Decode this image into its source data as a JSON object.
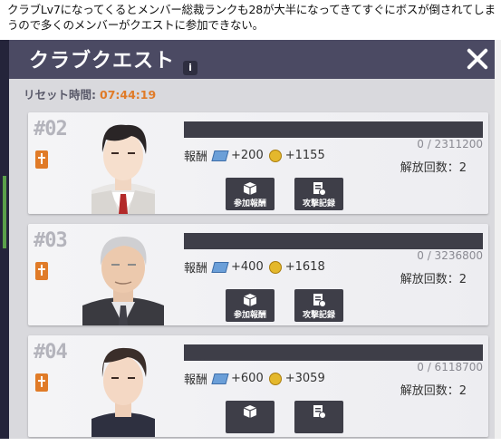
{
  "caption": "クラブLv7になってくるとメンバー総裁ランクも28が大半になってきてすぐにボスが倒されてしまうので多くのメンバーがクエストに参加できない。",
  "header": {
    "title": "クラブクエスト",
    "info_glyph": "i"
  },
  "reset": {
    "label": "リセット時間:",
    "time": "07:44:19"
  },
  "cards": [
    {
      "num": "#02",
      "reward_label": "報酬",
      "book": "+200",
      "coin": "+1155",
      "progress": "0 / 2311200",
      "release": "解放回数：2",
      "btn1": "参加報酬",
      "btn2": "攻撃記録"
    },
    {
      "num": "#03",
      "reward_label": "報酬",
      "book": "+400",
      "coin": "+1618",
      "progress": "0 / 3236800",
      "release": "解放回数：2",
      "btn1": "参加報酬",
      "btn2": "攻撃記録"
    },
    {
      "num": "#04",
      "reward_label": "報酬",
      "book": "+600",
      "coin": "+3059",
      "progress": "0 / 6118700",
      "release": "解放回数：2",
      "btn1": "",
      "btn2": ""
    }
  ],
  "colors": {
    "header": "#4b4a63",
    "accent": "#e07b28",
    "panel": "#d9d9dd"
  }
}
